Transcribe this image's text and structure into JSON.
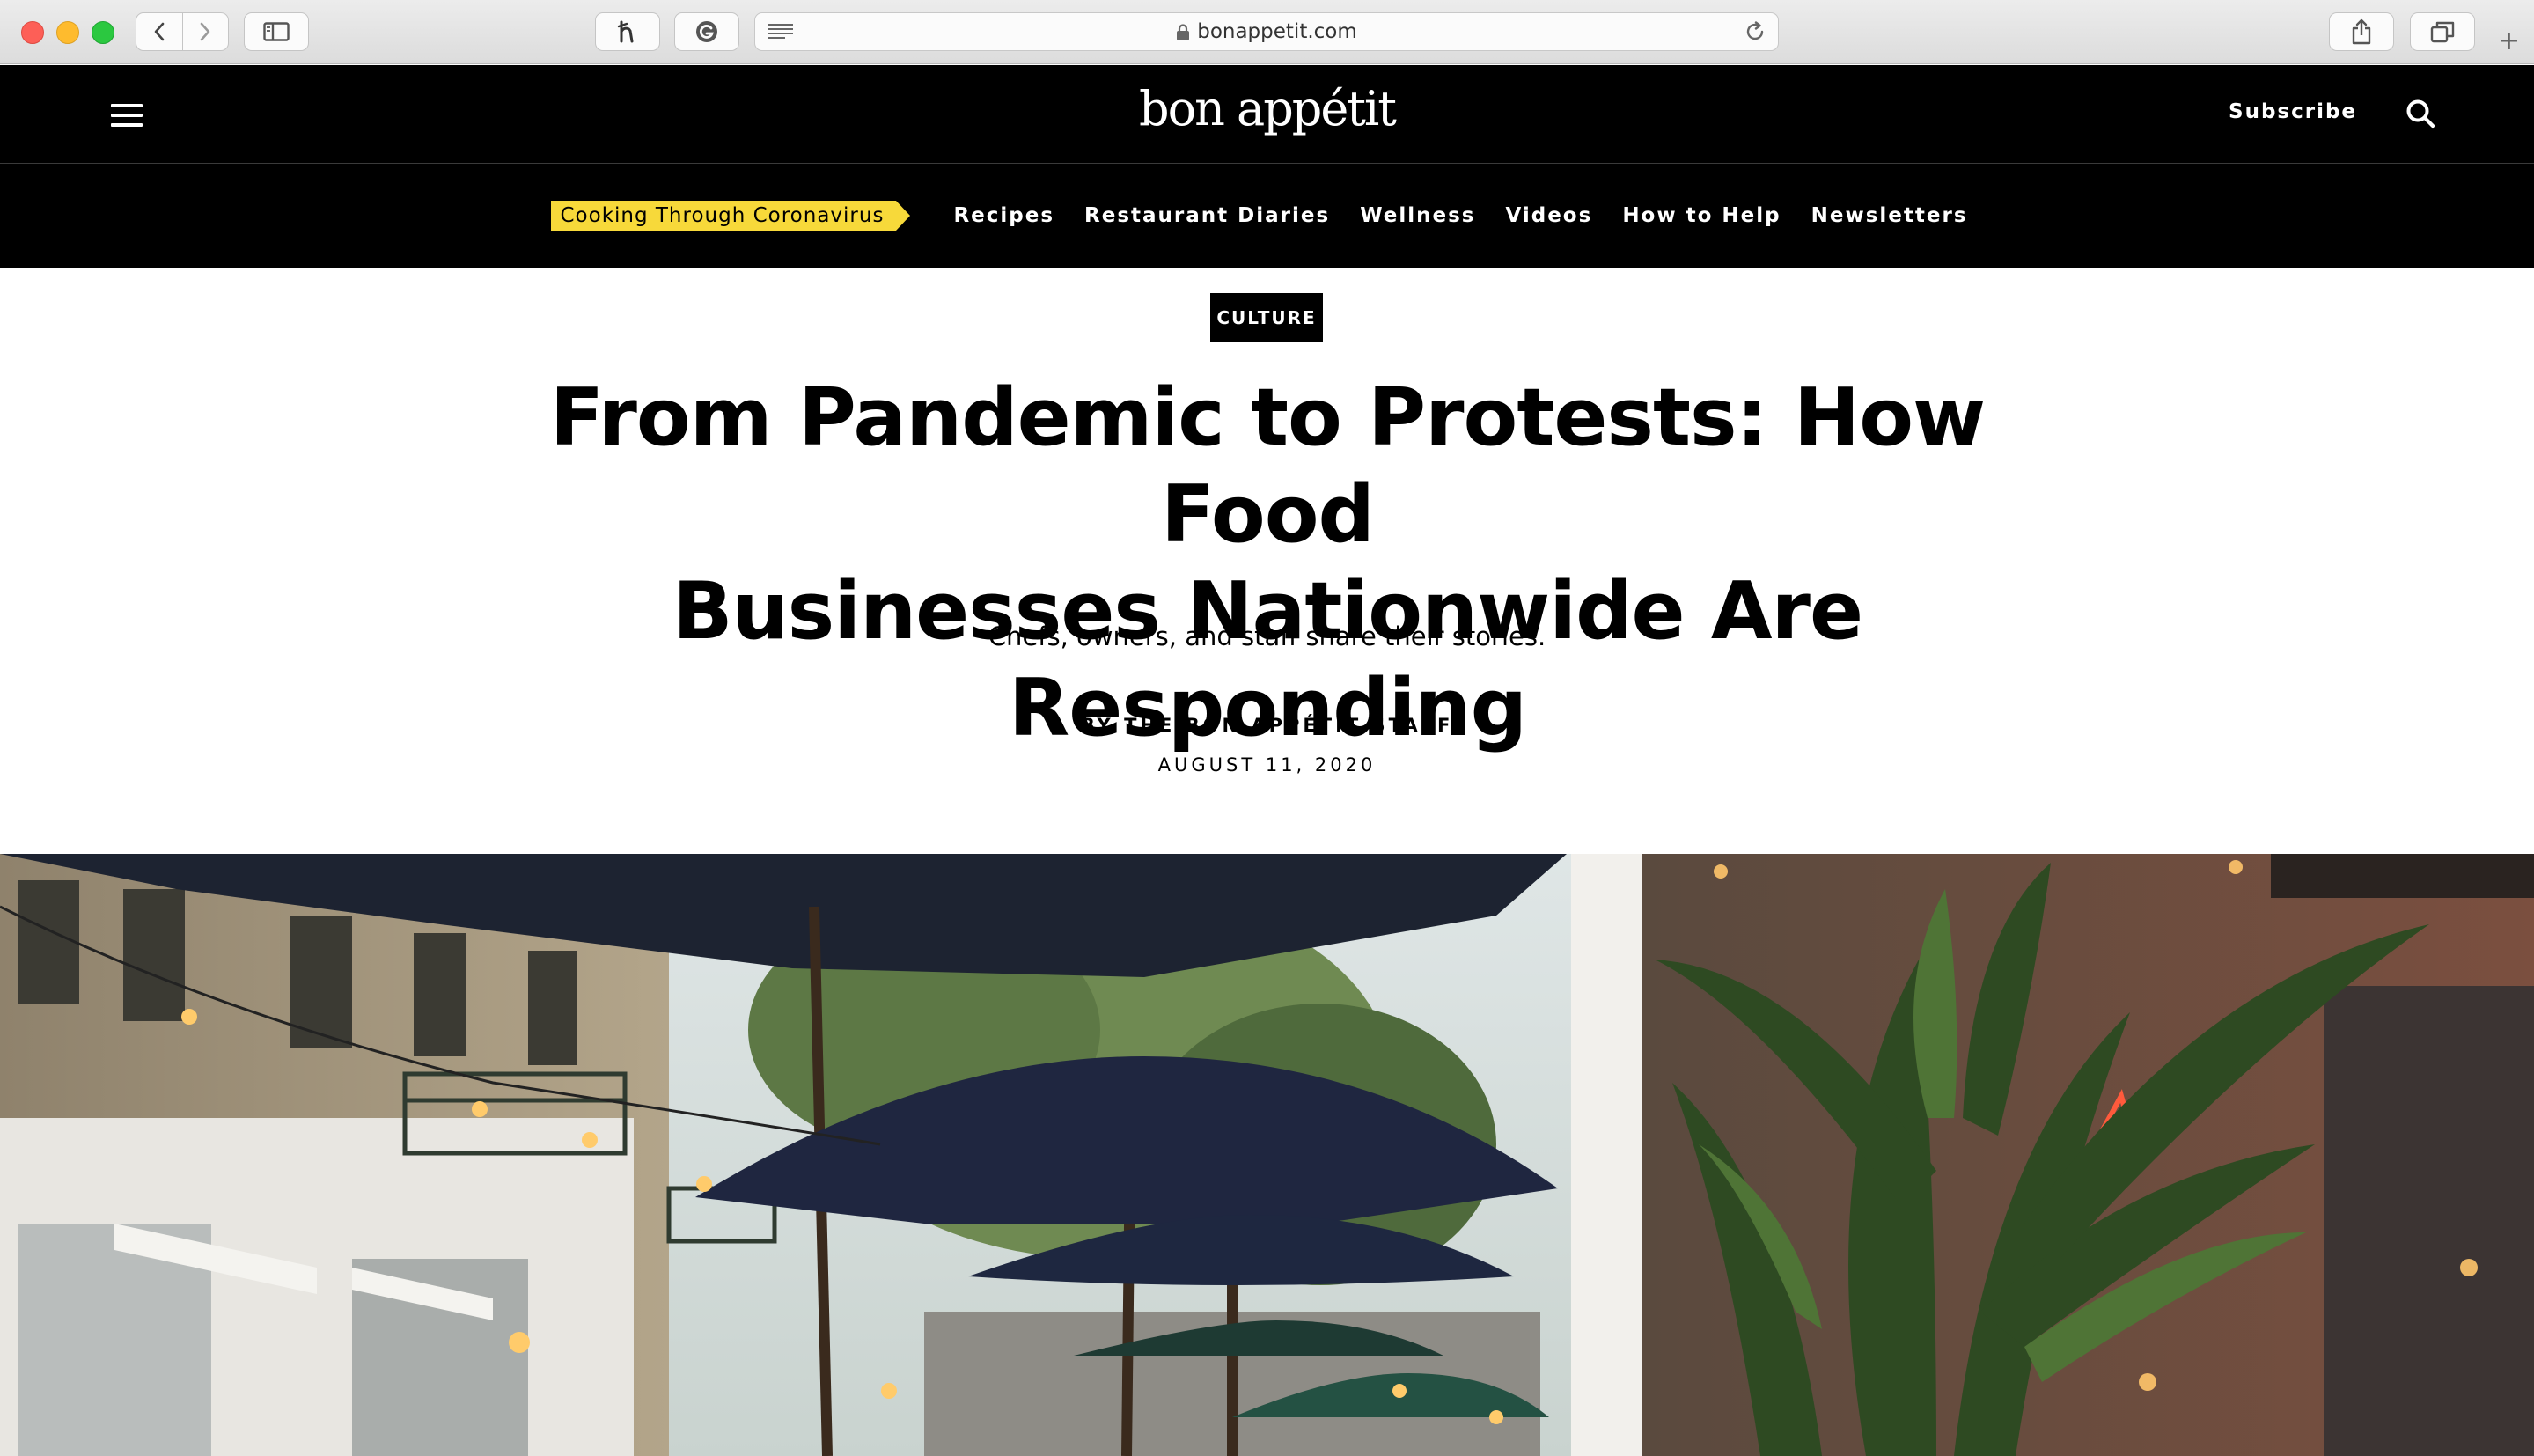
{
  "browser": {
    "url": "bonappetit.com",
    "tab_plus": "+",
    "icons": {
      "back": "chevron-left-icon",
      "forward": "chevron-right-icon",
      "sidebar": "sidebar-icon",
      "honey": "honey-extension-icon",
      "grammarly": "grammarly-extension-icon",
      "reader": "reader-icon",
      "lock": "lock-icon",
      "reload": "reload-icon",
      "share": "share-icon",
      "tabs": "tabs-overview-icon"
    }
  },
  "header": {
    "logo": "bon appétit",
    "subscribe": "Subscribe"
  },
  "nav": {
    "promo": "Cooking Through Coronavirus",
    "items": [
      {
        "label": "Recipes"
      },
      {
        "label": "Restaurant Diaries"
      },
      {
        "label": "Wellness"
      },
      {
        "label": "Videos"
      },
      {
        "label": "How to Help"
      },
      {
        "label": "Newsletters"
      }
    ]
  },
  "article": {
    "tag": "CULTURE",
    "headline_line1": "From Pandemic to Protests: How Food",
    "headline_line2": "Businesses Nationwide Are Responding",
    "dek": "Chefs, owners, and staff share their stories.",
    "byline": "BY THE BON APPÉTIT STAFF",
    "date": "AUGUST 11, 2020"
  },
  "colors": {
    "header_bg": "#000000",
    "promo_bg": "#f7d93a",
    "text": "#000000"
  }
}
